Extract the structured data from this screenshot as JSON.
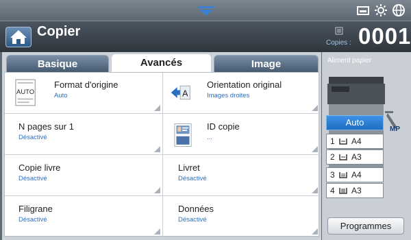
{
  "status_bar": {
    "icons": [
      "pull-down-arrow-icon",
      "toner-icon",
      "brightness-icon",
      "globe-icon"
    ]
  },
  "header": {
    "title": "Copier",
    "home_icon": "home-icon",
    "copies_label": "Copies :",
    "copies_count": "0001"
  },
  "tabs": [
    {
      "label": "Basique",
      "active": false
    },
    {
      "label": "Avancés",
      "active": true
    },
    {
      "label": "Image",
      "active": false
    }
  ],
  "options": [
    {
      "title": "Format d'origine",
      "value": "Auto",
      "icon": "original-size-icon",
      "icon_text": "AUTO"
    },
    {
      "title": "Orientation original",
      "value": "Images droites",
      "icon": "orientation-icon",
      "icon_text": "A"
    },
    {
      "title": "N pages sur 1",
      "value": "Désactivé"
    },
    {
      "title": "ID copie",
      "value": "...",
      "icon": "id-copy-icon"
    },
    {
      "title": "Copie livre",
      "value": "Désactivé"
    },
    {
      "title": "Livret",
      "value": "Désactivé"
    },
    {
      "title": "Filigrane",
      "value": "Désactivé"
    },
    {
      "title": "Données",
      "value": "Désactivé"
    }
  ],
  "sidebar": {
    "label": "Aliment papier",
    "mp_label": "MP",
    "trays": [
      {
        "num": "",
        "size": "Auto",
        "selected": true
      },
      {
        "num": "1",
        "size": "A4",
        "selected": false
      },
      {
        "num": "2",
        "size": "A3",
        "selected": false
      },
      {
        "num": "3",
        "size": "A4",
        "selected": false
      },
      {
        "num": "4",
        "size": "A3",
        "selected": false
      }
    ],
    "programs_button": "Programmes"
  },
  "colors": {
    "accent": "#2a6fc2",
    "selected_tray": "#1e6cc0",
    "header": "#2f363d"
  }
}
